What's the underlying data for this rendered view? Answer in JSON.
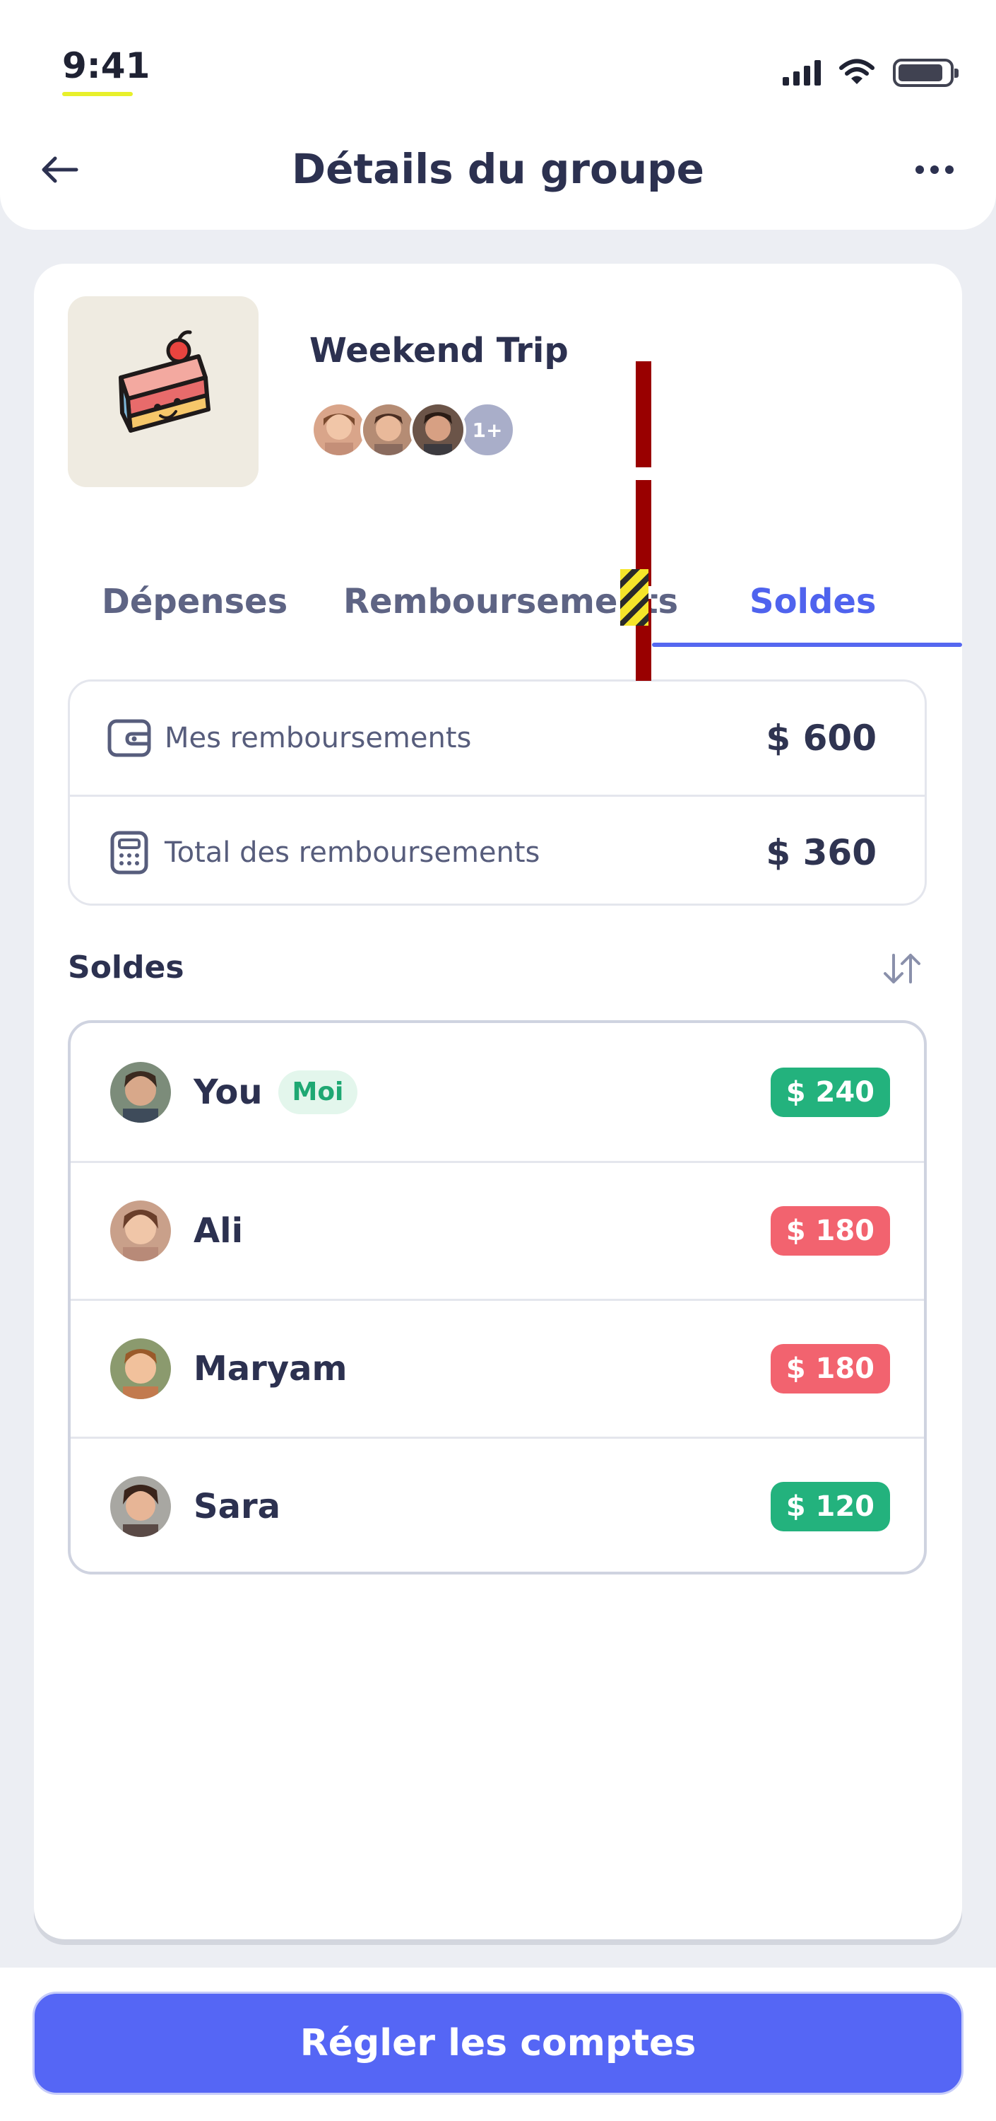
{
  "status": {
    "time": "9:41"
  },
  "header": {
    "title": "Détails du groupe",
    "back_icon": "arrow-left-icon",
    "more_icon": "more-horizontal-icon"
  },
  "group": {
    "name": "Weekend Trip",
    "image_icon": "cake-slice-icon",
    "extra_members": "1+"
  },
  "tabs": [
    {
      "label": "Dépenses",
      "active": false
    },
    {
      "label": "Remboursements",
      "active": false
    },
    {
      "label": "Soldes",
      "active": true
    }
  ],
  "summary": [
    {
      "icon": "wallet-icon",
      "label": "Mes remboursements",
      "amount": "$ 600"
    },
    {
      "icon": "calculator-icon",
      "label": "Total des remboursements",
      "amount": "$ 360"
    }
  ],
  "balances_section": {
    "title": "Soldes",
    "sort_icon": "sort-arrows-icon"
  },
  "balances": [
    {
      "name": "You",
      "tag": "Moi",
      "amount": "$ 240",
      "status": "positive"
    },
    {
      "name": "Ali",
      "tag": "",
      "amount": "$ 180",
      "status": "negative"
    },
    {
      "name": "Maryam",
      "tag": "",
      "amount": "$ 180",
      "status": "negative"
    },
    {
      "name": "Sara",
      "tag": "",
      "amount": "$ 120",
      "status": "positive"
    }
  ],
  "cta": {
    "label": "Régler les comptes"
  },
  "colors": {
    "accent": "#4f63ee",
    "positive": "#23b27d",
    "negative": "#f2636f",
    "background": "#eceef3"
  }
}
